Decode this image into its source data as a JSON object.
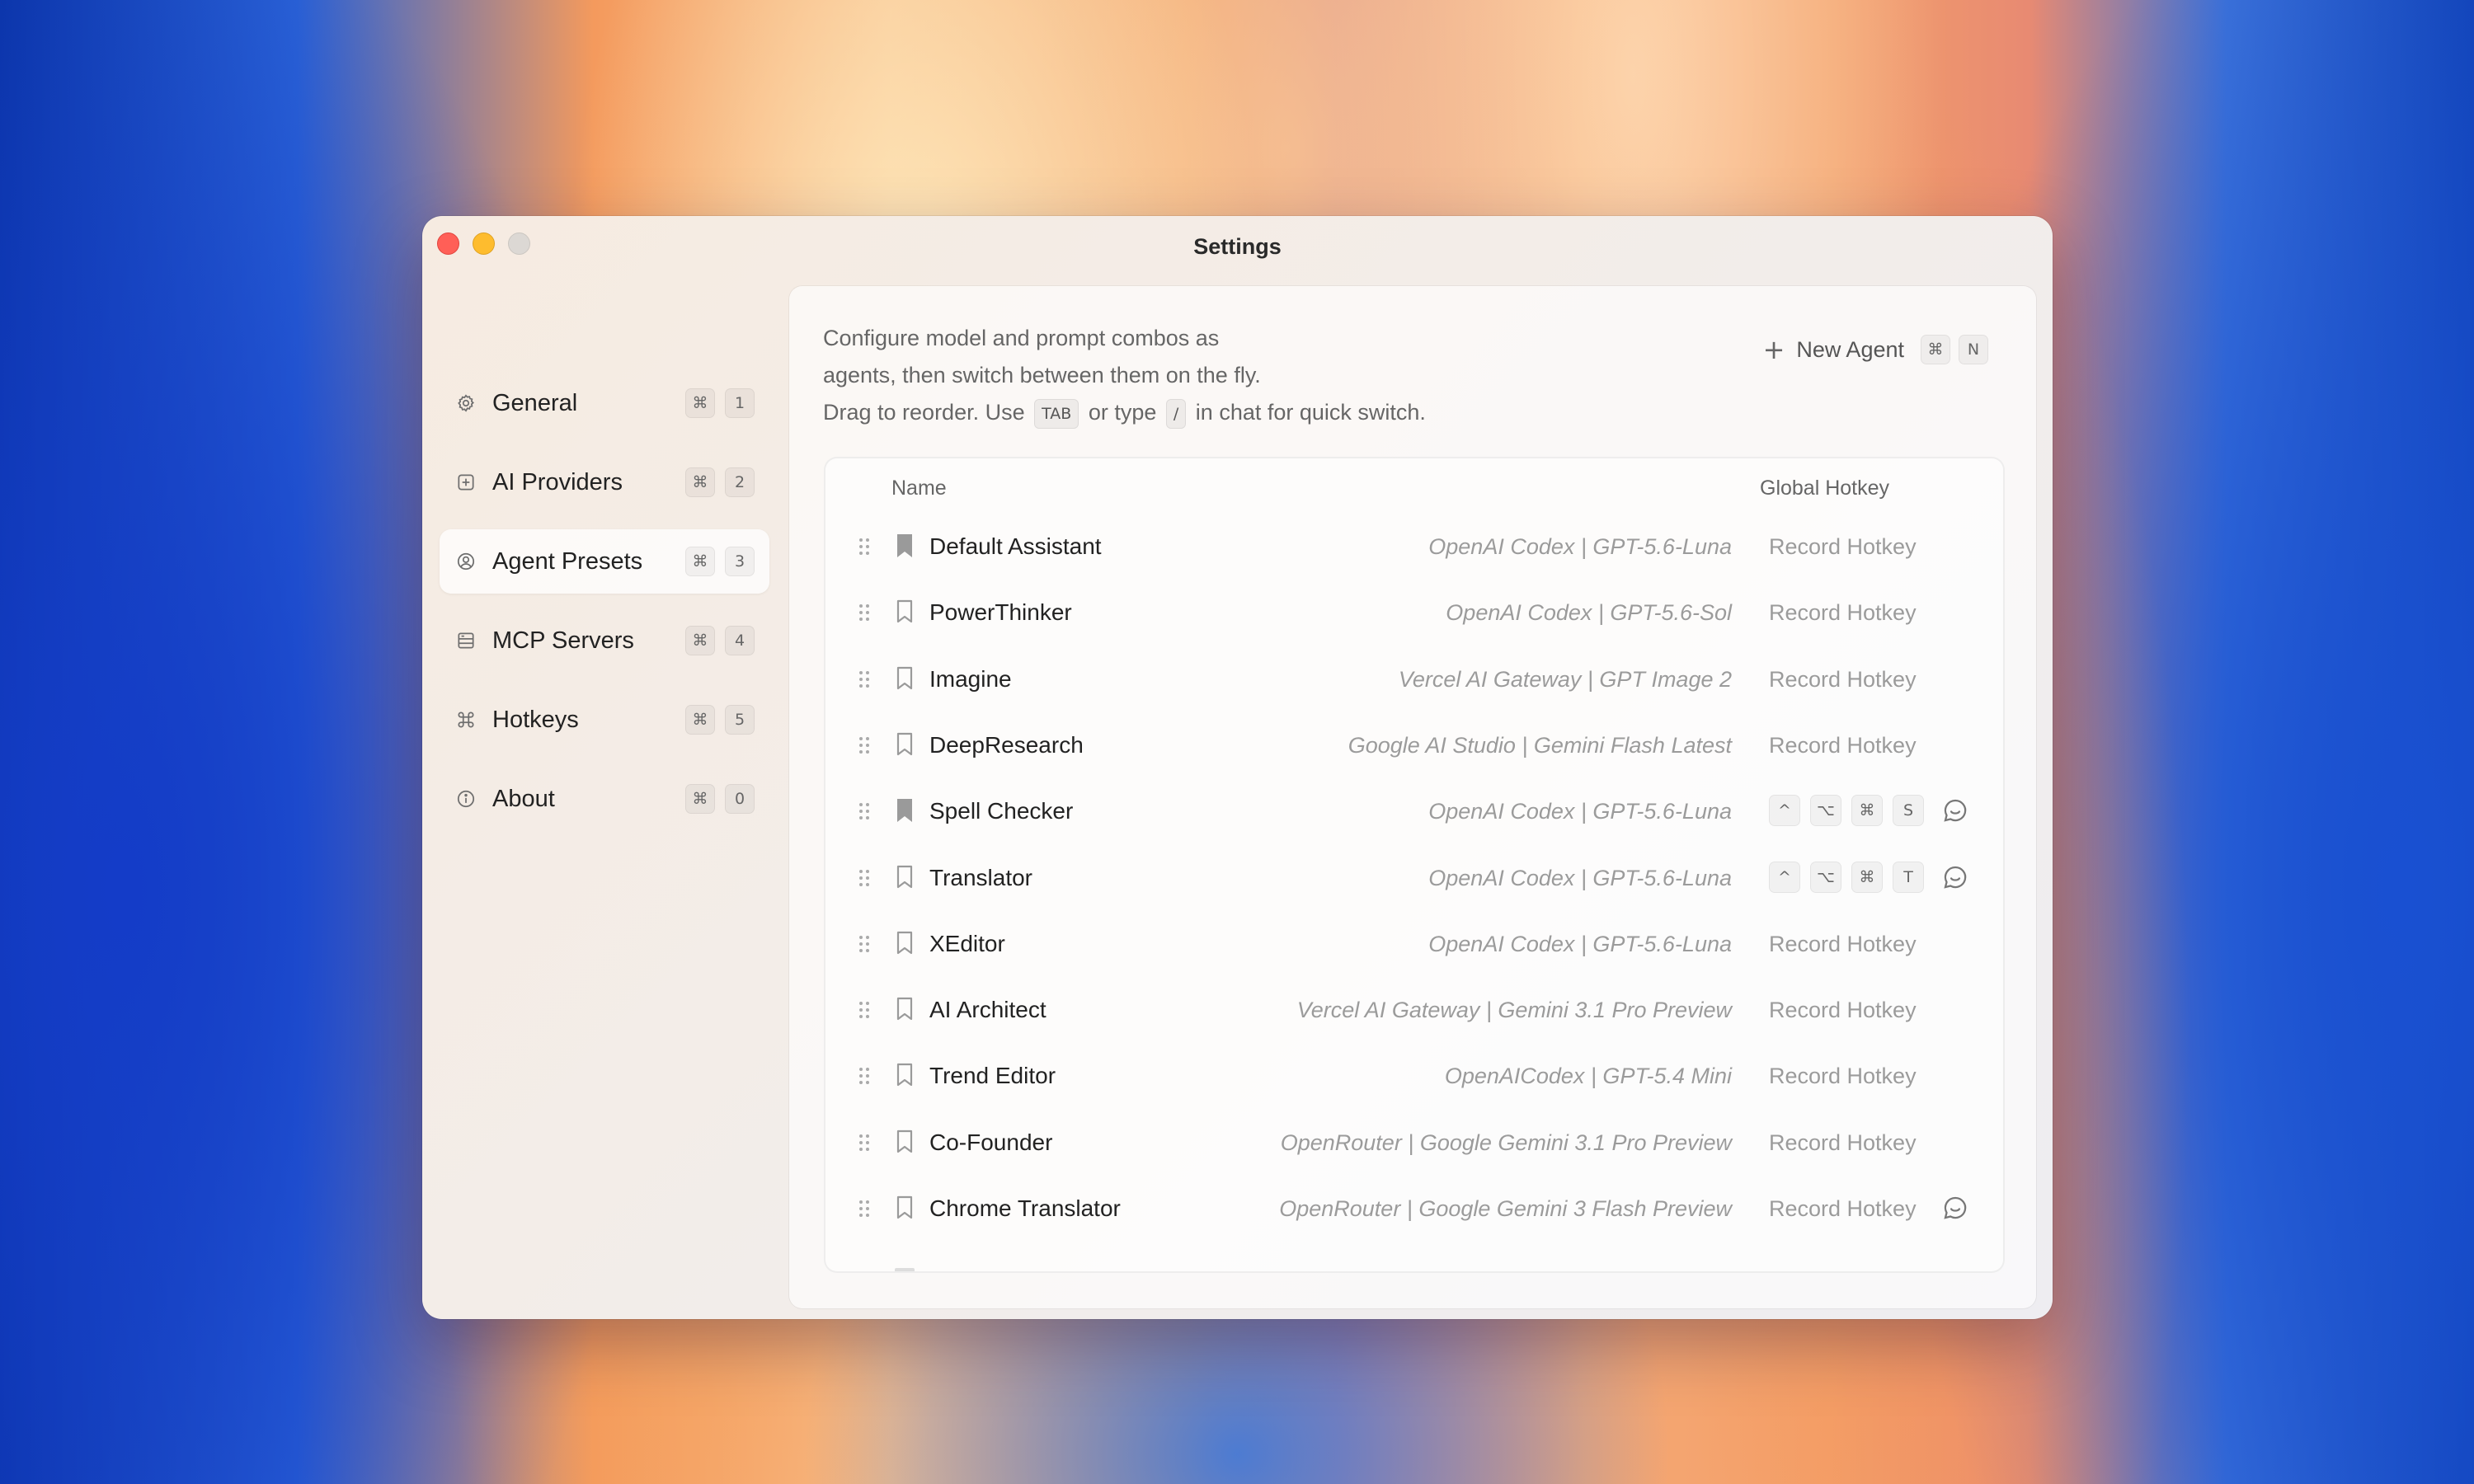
{
  "window": {
    "title": "Settings"
  },
  "sidebar": {
    "items": [
      {
        "label": "General",
        "icon": "gear-icon",
        "mod": "⌘",
        "key": "1"
      },
      {
        "label": "AI Providers",
        "icon": "plus-box-icon",
        "mod": "⌘",
        "key": "2"
      },
      {
        "label": "Agent Presets",
        "icon": "person-circle-icon",
        "mod": "⌘",
        "key": "3"
      },
      {
        "label": "MCP Servers",
        "icon": "server-icon",
        "mod": "⌘",
        "key": "4"
      },
      {
        "label": "Hotkeys",
        "icon": "command-icon",
        "mod": "⌘",
        "key": "5"
      },
      {
        "label": "About",
        "icon": "info-icon",
        "mod": "⌘",
        "key": "0"
      }
    ],
    "active": "Agent Presets"
  },
  "main": {
    "description": {
      "line1": "Configure model and prompt combos as",
      "line2": "agents, then switch between them on the fly.",
      "line3_a": "Drag to reorder. Use",
      "line3_key1": "TAB",
      "line3_b": "or type",
      "line3_key2": "/",
      "line3_c": "in chat for quick switch."
    },
    "new_agent": {
      "label": "New Agent",
      "mod": "⌘",
      "key": "N"
    },
    "table": {
      "headers": {
        "name": "Name",
        "hotkey": "Global Hotkey"
      },
      "rows": [
        {
          "name": "Default Assistant",
          "model": "OpenAI Codex | GPT-5.6-Luna",
          "hotkey": "Record Hotkey",
          "keys": [],
          "bookmark_filled": true,
          "chat_icon": false
        },
        {
          "name": "PowerThinker",
          "model": "OpenAI Codex | GPT-5.6-Sol",
          "hotkey": "Record Hotkey",
          "keys": [],
          "bookmark_filled": false,
          "chat_icon": false
        },
        {
          "name": "Imagine",
          "model": "Vercel AI Gateway | GPT Image 2",
          "hotkey": "Record Hotkey",
          "keys": [],
          "bookmark_filled": false,
          "chat_icon": false
        },
        {
          "name": "DeepResearch",
          "model": "Google AI Studio | Gemini Flash Latest",
          "hotkey": "Record Hotkey",
          "keys": [],
          "bookmark_filled": false,
          "chat_icon": false
        },
        {
          "name": "Spell Checker",
          "model": "OpenAI Codex | GPT-5.6-Luna",
          "hotkey": "",
          "keys": [
            "^",
            "⌥",
            "⌘",
            "S"
          ],
          "bookmark_filled": true,
          "chat_icon": true
        },
        {
          "name": "Translator",
          "model": "OpenAI Codex | GPT-5.6-Luna",
          "hotkey": "",
          "keys": [
            "^",
            "⌥",
            "⌘",
            "T"
          ],
          "bookmark_filled": false,
          "chat_icon": true
        },
        {
          "name": "XEditor",
          "model": "OpenAI Codex | GPT-5.6-Luna",
          "hotkey": "Record Hotkey",
          "keys": [],
          "bookmark_filled": false,
          "chat_icon": false
        },
        {
          "name": "AI Architect",
          "model": "Vercel AI Gateway | Gemini 3.1 Pro Preview",
          "hotkey": "Record Hotkey",
          "keys": [],
          "bookmark_filled": false,
          "chat_icon": false
        },
        {
          "name": "Trend Editor",
          "model": "OpenAICodex | GPT-5.4 Mini",
          "hotkey": "Record Hotkey",
          "keys": [],
          "bookmark_filled": false,
          "chat_icon": false
        },
        {
          "name": "Co-Founder",
          "model": "OpenRouter | Google Gemini 3.1 Pro Preview",
          "hotkey": "Record Hotkey",
          "keys": [],
          "bookmark_filled": false,
          "chat_icon": false
        },
        {
          "name": "Chrome Translator",
          "model": "OpenRouter | Google Gemini 3 Flash Preview",
          "hotkey": "Record Hotkey",
          "keys": [],
          "bookmark_filled": false,
          "chat_icon": true
        }
      ]
    }
  }
}
